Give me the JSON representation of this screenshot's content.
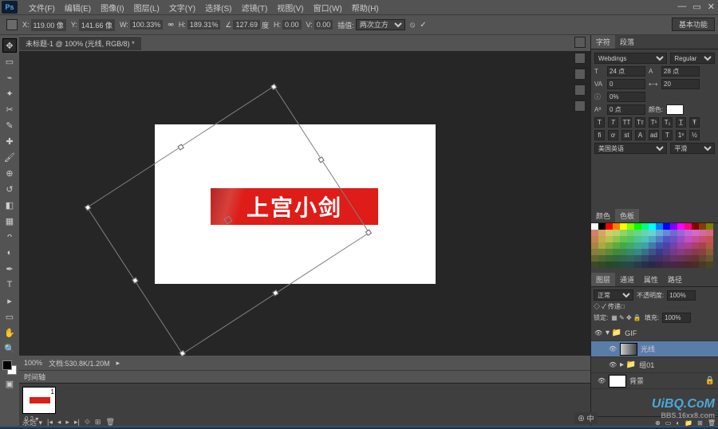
{
  "menu": [
    "文件(F)",
    "编辑(E)",
    "图像(I)",
    "图层(L)",
    "文字(Y)",
    "选择(S)",
    "滤镜(T)",
    "视图(V)",
    "窗口(W)",
    "帮助(H)"
  ],
  "workspace": "基本功能",
  "options": {
    "x": "119.00 像",
    "y": "141.66 像",
    "w": "100.33%",
    "h": "189.31%",
    "angle": "127.69",
    "du": "度",
    "hlbl": "H:",
    "h2": "0.00",
    "vlbl": "V:",
    "v": "0.00",
    "interp_lbl": "插值:",
    "interp": "两次立方"
  },
  "doc_tab": "未标题-1 @ 100% (光线, RGB/8) *",
  "canvas_text": "上宫小剑",
  "status": {
    "zoom": "100%",
    "doc": "文档:530.8K/1.20M"
  },
  "timeline_tab": "时间轴",
  "frame": {
    "num": "1",
    "delay": "0.2 ▾"
  },
  "tl_loop": "永远 ▾",
  "char": {
    "tab_char": "字符",
    "tab_para": "段落",
    "font": "Webdings",
    "style": "Regular",
    "size_lbl": "T",
    "size": "24 点",
    "lead_lbl": "A",
    "leading": "28 点",
    "va": "VA",
    "tracking": "0",
    "kern": "20",
    "scale": "0%",
    "baseline": "0 点",
    "color_lbl": "颜色:",
    "lang": "美国英语",
    "aa": "平滑"
  },
  "swatches": {
    "tab1": "颜色",
    "tab2": "色板"
  },
  "layers": {
    "t1": "图层",
    "t2": "通道",
    "t3": "属性",
    "t4": "路径",
    "blend": "正常",
    "op_lbl": "不透明度:",
    "opacity": "100%",
    "lock_lbl": "锁定:",
    "fill_lbl": "填充:",
    "fill": "100%",
    "group": "GIF",
    "items": [
      {
        "name": "光线",
        "kind": "mask",
        "sel": true
      },
      {
        "name": "组01",
        "kind": "folder",
        "sel": false
      },
      {
        "name": "背景",
        "kind": "bg",
        "sel": false
      }
    ]
  },
  "watermark": "UiBQ.CoM",
  "watermark2": "BBS.16xx8.com",
  "ime": "⊕ 中"
}
